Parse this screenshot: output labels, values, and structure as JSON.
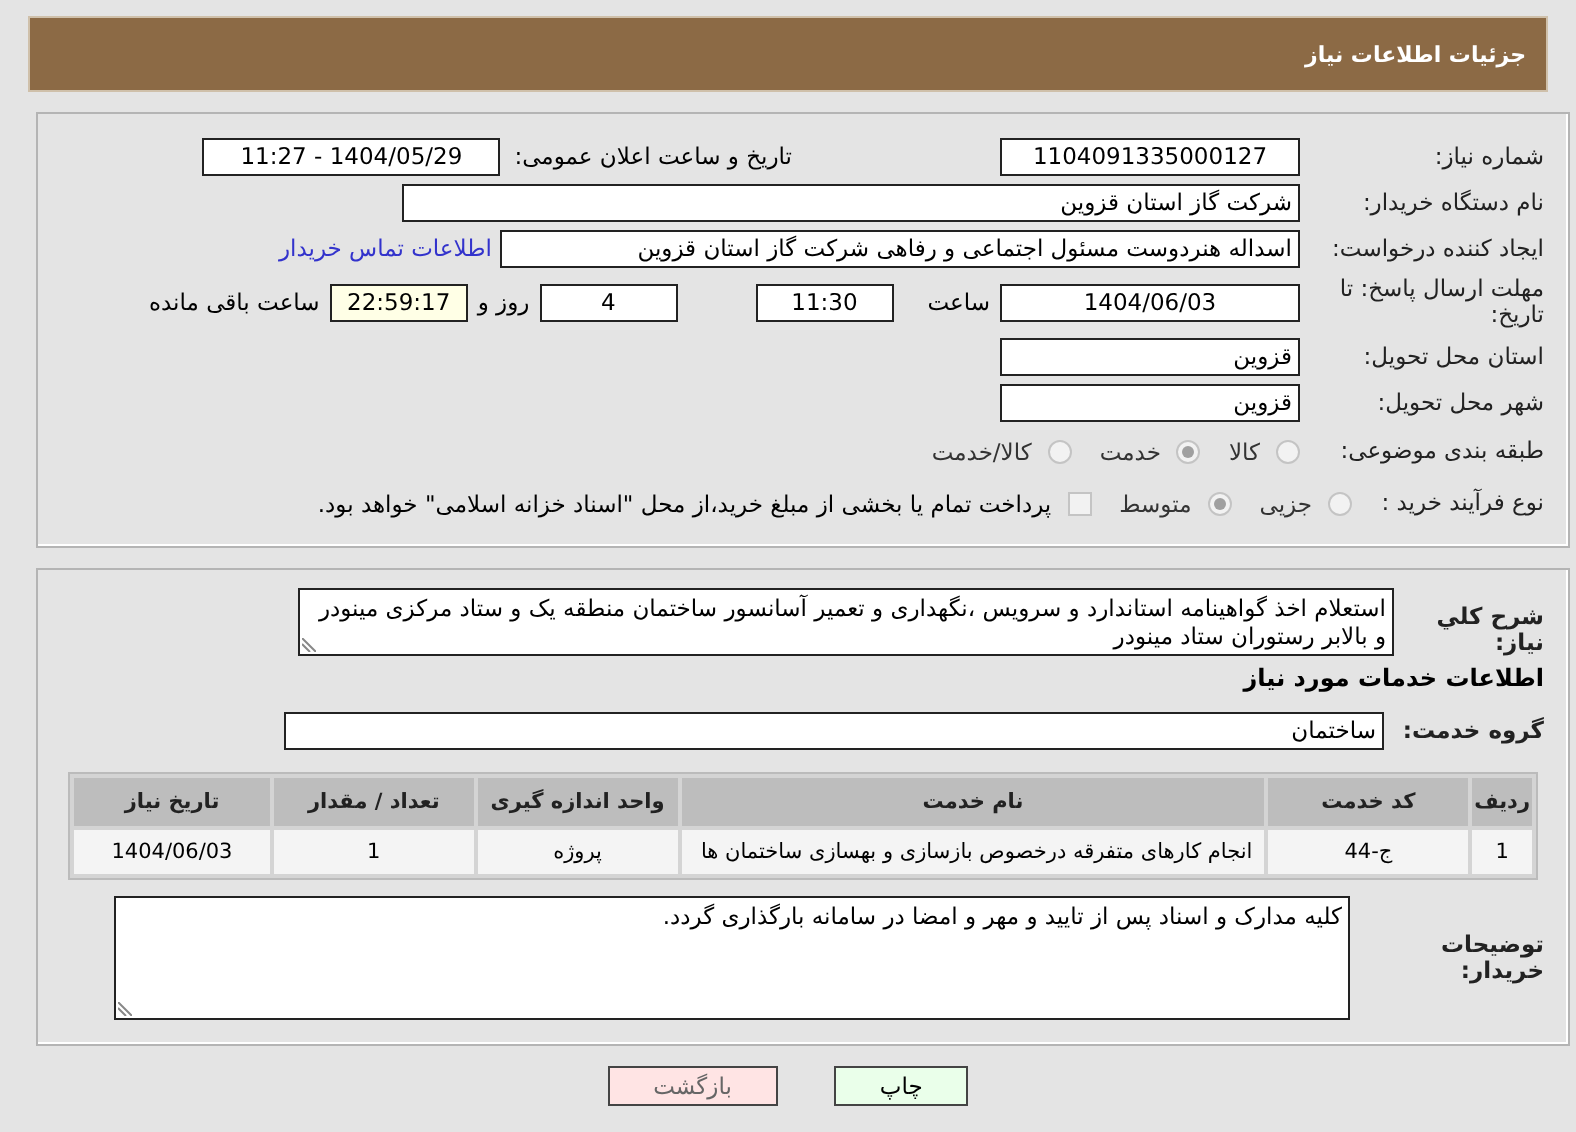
{
  "header": {
    "title": "جزئیات اطلاعات نیاز"
  },
  "need_info": {
    "need_number": {
      "label": "شماره نیاز:",
      "value": "1104091335000127"
    },
    "announce_datetime": {
      "label": "تاریخ و ساعت اعلان عمومی:",
      "value": "1404/05/29 - 11:27"
    },
    "buyer_org": {
      "label": "نام دستگاه خریدار:",
      "value": "شرکت گاز استان قزوین"
    },
    "requester": {
      "label": "ایجاد کننده درخواست:",
      "value": "اسداله هنردوست مسئول اجتماعی و رفاهی شرکت گاز استان قزوین",
      "contact_link": "اطلاعات تماس خریدار"
    },
    "deadline": {
      "label": "مهلت ارسال پاسخ: تا تاریخ:",
      "date": "1404/06/03",
      "time_label": "ساعت",
      "time": "11:30",
      "days": "4",
      "days_label": "روز و",
      "remaining": "22:59:17",
      "remaining_label": "ساعت باقی مانده"
    },
    "province": {
      "label": "استان محل تحویل:",
      "value": "قزوین"
    },
    "city": {
      "label": "شهر محل تحویل:",
      "value": "قزوین"
    },
    "category": {
      "label": "طبقه بندی موضوعی:",
      "options": [
        {
          "label": "کالا",
          "selected": false
        },
        {
          "label": "خدمت",
          "selected": true
        },
        {
          "label": "کالا/خدمت",
          "selected": false
        }
      ]
    },
    "process": {
      "label": "نوع فرآیند خرید :",
      "options": [
        {
          "label": "جزیی",
          "selected": false
        },
        {
          "label": "متوسط",
          "selected": true
        }
      ],
      "treasury": {
        "checked": false,
        "text": "پرداخت تمام یا بخشی از مبلغ خرید،از محل \"اسناد خزانه اسلامی\" خواهد بود."
      }
    }
  },
  "details": {
    "description": {
      "label": "شرح کلي نیاز:",
      "value": "استعلام اخذ گواهینامه استاندارد و سرویس ،نگهداری و تعمیر آسانسور ساختمان منطقه یک و ستاد مرکزی مینودر و بالابر رستوران ستاد مینودر"
    },
    "services_title": "اطلاعات خدمات مورد نیاز",
    "service_group": {
      "label": "گروه خدمت:",
      "value": "ساختمان"
    },
    "table": {
      "columns": [
        "ردیف",
        "کد خدمت",
        "نام خدمت",
        "واحد اندازه گیری",
        "تعداد / مقدار",
        "تاریخ نیاز"
      ],
      "rows": [
        [
          "1",
          "ج-44",
          "انجام کارهای متفرقه درخصوص بازسازی و بهسازی ساختمان ها",
          "پروژه",
          "1",
          "1404/06/03"
        ]
      ]
    },
    "buyer_notes": {
      "label": "توضیحات خریدار:",
      "value": "کلیه مدارک و اسناد پس از تایید و مهر و امضا در سامانه بارگذاری گردد."
    }
  },
  "buttons": [
    {
      "label": "چاپ",
      "kind": "print"
    },
    {
      "label": "بازگشت",
      "kind": "back"
    }
  ]
}
